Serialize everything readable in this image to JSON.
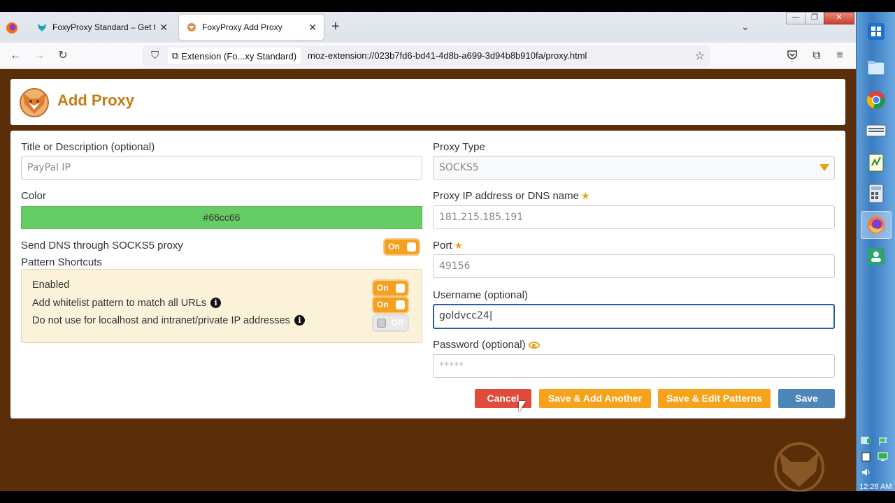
{
  "browser": {
    "tabs": [
      {
        "title": "FoxyProxy Standard – Get this E",
        "state": "inactive"
      },
      {
        "title": "FoxyProxy Add Proxy",
        "state": "active"
      }
    ],
    "url_identity": "Extension (Fo...xy Standard)",
    "url": "moz-extension://023b7fd6-bd41-4d8b-a699-3d94b8b910fa/proxy.html"
  },
  "page": {
    "title": "Add Proxy"
  },
  "form": {
    "title_label": "Title or Description (optional)",
    "title_value": "PayPal IP",
    "color_label": "Color",
    "color_value": "#66cc66",
    "dns_label": "Send DNS through SOCKS5 proxy",
    "dns_toggle": "On",
    "pattern_shortcuts_label": "Pattern Shortcuts",
    "shortcuts": [
      {
        "label": "Enabled",
        "state": "On"
      },
      {
        "label": "Add whitelist pattern to match all URLs",
        "state": "On",
        "info": true
      },
      {
        "label": "Do not use for localhost and intranet/private IP addresses",
        "state": "Off",
        "info": true
      }
    ],
    "proxy_type_label": "Proxy Type",
    "proxy_type_value": "SOCKS5",
    "ip_label": "Proxy IP address or DNS name",
    "ip_value": "181.215.185.191",
    "port_label": "Port",
    "port_value": "49156",
    "username_label": "Username (optional)",
    "username_value": "goldvcc24",
    "password_label": "Password (optional)",
    "password_value": "*****"
  },
  "buttons": {
    "cancel": "Cancel",
    "save_add_another": "Save & Add Another",
    "save_edit_patterns": "Save & Edit Patterns",
    "save": "Save"
  },
  "taskbar": {
    "clock": "12:28 AM"
  },
  "colors": {
    "accent": "#c67b12",
    "toggle_on": "#f5a020",
    "cancel": "#e14b3b",
    "save": "#4d86b8",
    "page_bg": "#5a2e08"
  }
}
